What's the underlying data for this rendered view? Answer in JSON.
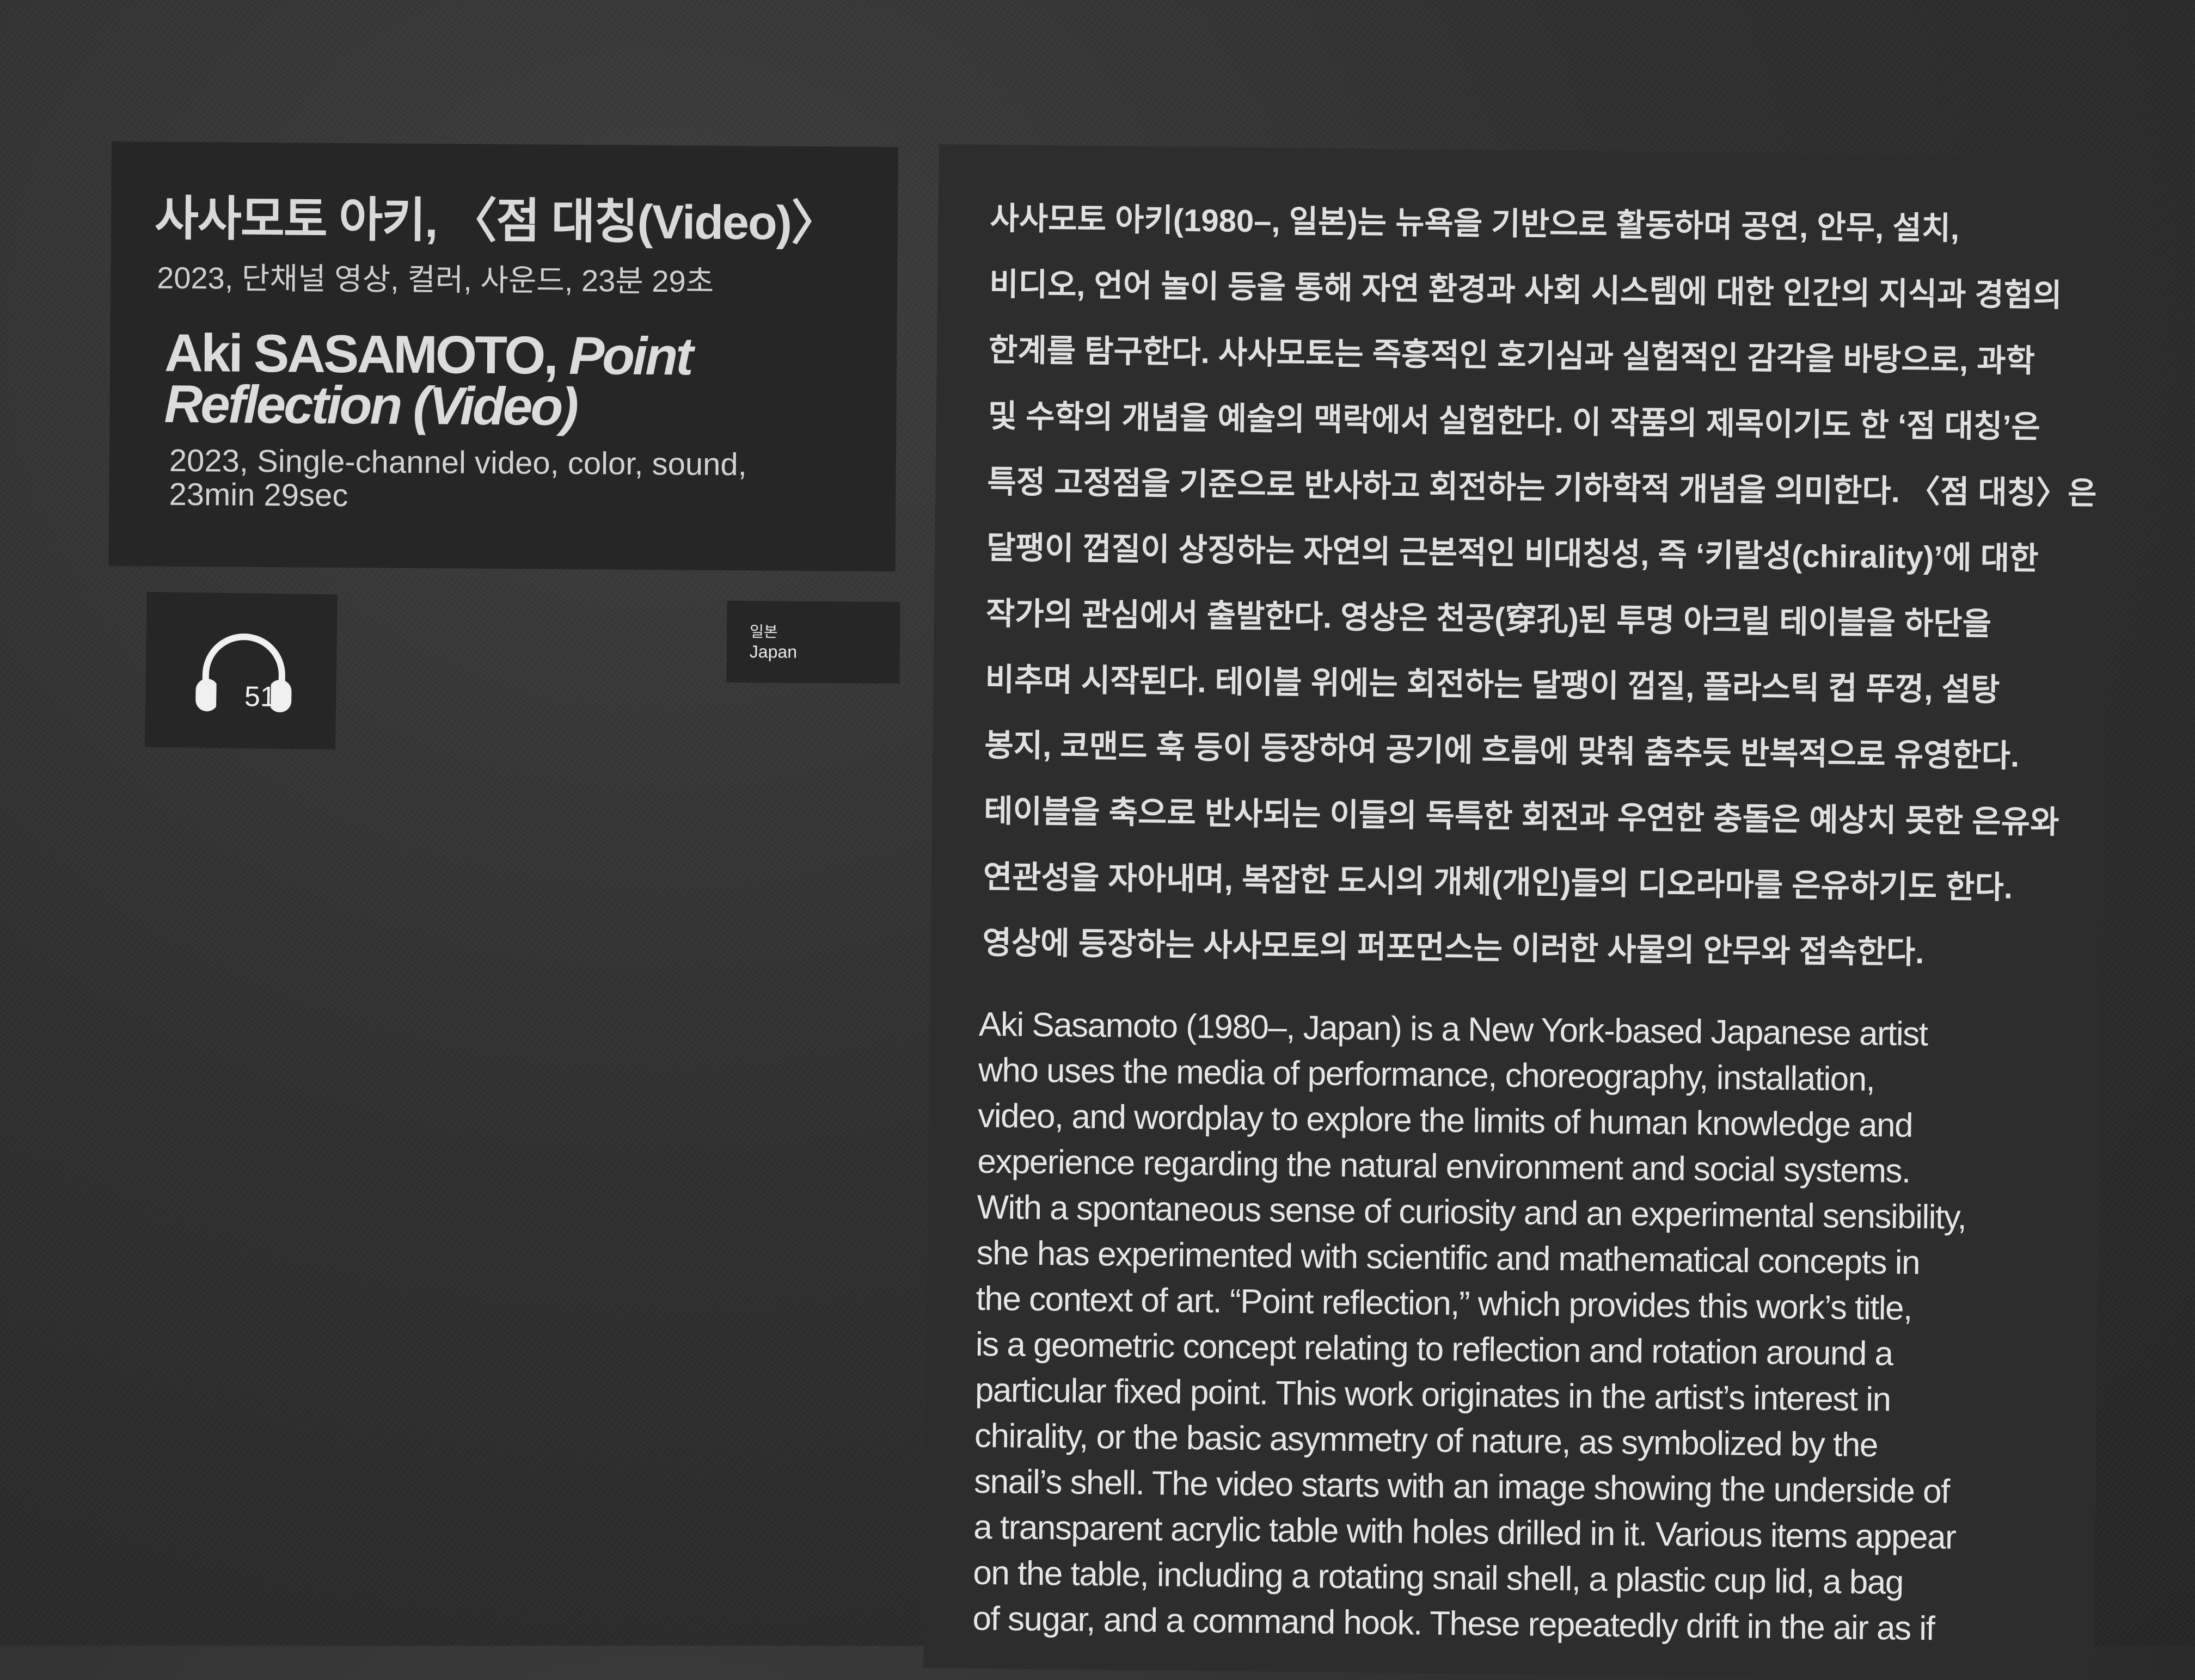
{
  "label": {
    "title_ko": "사사모토 아키, 〈점 대칭(Video)〉",
    "meta_ko": "2023, 단채널 영상, 컬러, 사운드, 23분 29초",
    "title_en_artist": "Aki SASAMOTO,",
    "title_en_work": "Point Reflection (Video)",
    "meta_en": "2023, Single-channel video, color, sound, 23min 29sec"
  },
  "audio_guide": {
    "icon": "headphones-icon",
    "number": "519"
  },
  "country": {
    "ko": "일본",
    "en": "Japan"
  },
  "description_ko": [
    "사사모토 아키(1980–, 일본)는 뉴욕을 기반으로 활동하며 공연, 안무, 설치,",
    "비디오, 언어 놀이 등을 통해 자연 환경과 사회 시스템에 대한 인간의 지식과 경험의",
    "한계를 탐구한다. 사사모토는 즉흥적인 호기심과 실험적인 감각을 바탕으로, 과학",
    "및 수학의 개념을 예술의 맥락에서 실험한다. 이 작품의 제목이기도 한 ‘점 대칭’은",
    "특정 고정점을 기준으로 반사하고 회전하는 기하학적 개념을 의미한다. 〈점 대칭〉은",
    "달팽이 껍질이 상징하는 자연의 근본적인 비대칭성, 즉 ‘키랄성(chirality)’에 대한",
    "작가의 관심에서 출발한다. 영상은 천공(穿孔)된 투명 아크릴 테이블을 하단을",
    "비추며 시작된다. 테이블 위에는 회전하는 달팽이 껍질, 플라스틱 컵 뚜껑, 설탕",
    "봉지, 코맨드 훅 등이 등장하여 공기에 흐름에 맞춰 춤추듯 반복적으로 유영한다.",
    "테이블을 축으로 반사되는 이들의 독특한 회전과 우연한 충돌은 예상치 못한 은유와",
    "연관성을 자아내며, 복잡한 도시의 개체(개인)들의 디오라마를 은유하기도 한다.",
    "영상에 등장하는 사사모토의 퍼포먼스는 이러한 사물의 안무와 접속한다."
  ],
  "description_en": [
    "Aki Sasamoto (1980–, Japan) is a New York-based Japanese artist",
    "who uses the media of performance, choreography, installation,",
    "video, and wordplay to explore the limits of human knowledge and",
    "experience regarding the natural environment and social systems.",
    "With a spontaneous sense of curiosity and an experimental sensibility,",
    "she has experimented with scientific and mathematical concepts in",
    "the context of art. “Point reflection,” which provides this work’s title,",
    "is a geometric concept relating to reflection and rotation around a",
    "particular fixed point. This work originates in the artist’s interest in",
    "chirality, or the basic asymmetry of nature, as symbolized by the",
    "snail’s shell. The video starts with an image showing the underside of",
    "a transparent acrylic table with holes drilled in it. Various items appear",
    "on the table, including a rotating snail shell, a plastic cup lid, a bag",
    "of sugar, and a command hook. These repeatedly drift in the air as if"
  ]
}
